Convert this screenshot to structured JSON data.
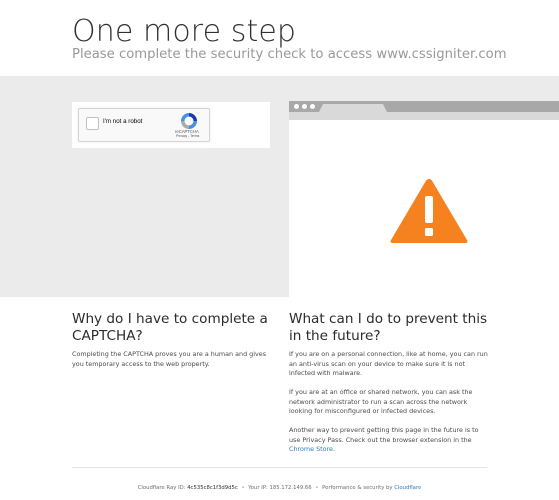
{
  "header": {
    "title": "One more step",
    "subtitle": "Please complete the security check to access www.cssigniter.com"
  },
  "captcha": {
    "label": "I'm not a robot",
    "brand": "reCAPTCHA",
    "links": "Privacy - Terms"
  },
  "left_column": {
    "heading": "Why do I have to complete a CAPTCHA?",
    "body": "Completing the CAPTCHA proves you are a human and gives you temporary access to the web property."
  },
  "right_column": {
    "heading": "What can I do to prevent this in the future?",
    "para1": "If you are on a personal connection, like at home, you can run an anti-virus scan on your device to make sure it is not infected with malware.",
    "para2": "If you are at an office or shared network, you can ask the network administrator to run a scan across the network looking for misconfigured or infected devices.",
    "para3_prefix": "Another way to prevent getting this page in the future is to use Privacy Pass. Check out the browser extension in the",
    "para3_link": "Chrome Store",
    "para3_suffix": "."
  },
  "footer": {
    "ray_label": "Cloudflare Ray ID:",
    "ray_id": "4c535c8c1f3d9d5c",
    "ip_label": "Your IP:",
    "ip": "185.172.149.66",
    "perf_label": "Performance & security by",
    "perf_link": "Cloudflare",
    "separator": "•"
  },
  "colors": {
    "warning_orange": "#f6821f",
    "band_gray": "#ebebeb",
    "link_blue": "#2f7bbf"
  },
  "icons": [
    "recaptcha-logo-icon",
    "warning-triangle-icon"
  ]
}
